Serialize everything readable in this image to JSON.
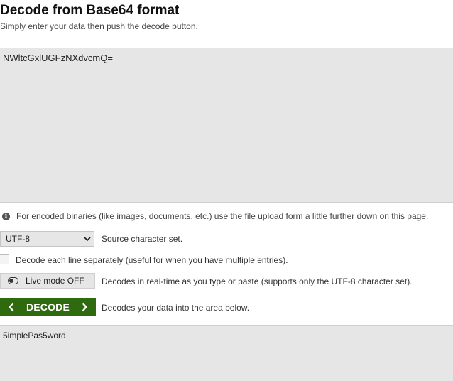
{
  "header": {
    "title": "Decode from Base64 format",
    "subtitle": "Simply enter your data then push the decode button."
  },
  "input": {
    "value": "NWltcGxlUGFzNXdvcmQ="
  },
  "info": {
    "icon": "info-icon",
    "text": "For encoded binaries (like images, documents, etc.) use the file upload form a little further down on this page."
  },
  "charset": {
    "selected": "UTF-8",
    "label": "Source character set."
  },
  "each_line": {
    "checked": false,
    "label": "Decode each line separately (useful for when you have multiple entries)."
  },
  "live_mode": {
    "button_label": "Live mode OFF",
    "description": "Decodes in real-time as you type or paste (supports only the UTF-8 character set)."
  },
  "decode": {
    "button_label": "DECODE",
    "description": "Decodes your data into the area below.",
    "color": "#2f6a0e"
  },
  "output": {
    "value": "5implePas5word"
  }
}
